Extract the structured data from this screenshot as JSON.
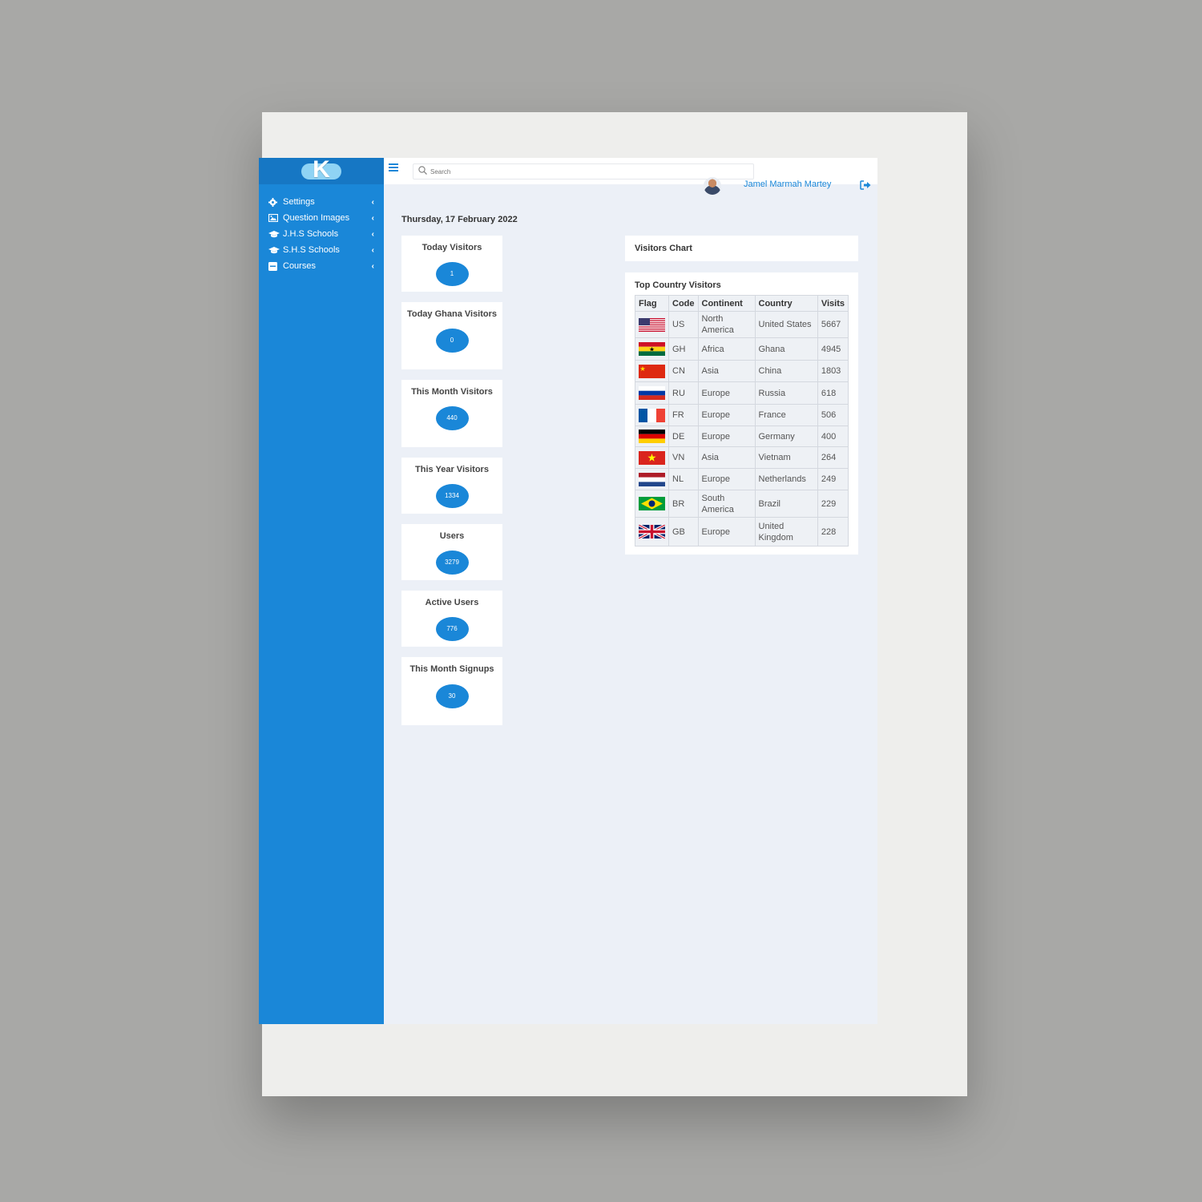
{
  "app": {
    "logo_letter": "K",
    "logo_colors": {
      "letter": "#ffffff",
      "cloud": "#8fd3f4"
    }
  },
  "sidebar": {
    "items": [
      {
        "label": "Settings",
        "icon": "gear-icon"
      },
      {
        "label": "Question Images",
        "icon": "image-icon"
      },
      {
        "label": "J.H.S Schools",
        "icon": "graduation-cap-icon"
      },
      {
        "label": "S.H.S Schools",
        "icon": "graduation-cap-icon"
      },
      {
        "label": "Courses",
        "icon": "book-icon"
      }
    ]
  },
  "header": {
    "search_placeholder": "Search",
    "user_name": "Jamel Marmah Martey"
  },
  "main": {
    "date": "Thursday, 17 February 2022",
    "stats": [
      {
        "title": "Today Visitors",
        "value": "1"
      },
      {
        "title": "Today Ghana Visitors",
        "value": "0"
      },
      {
        "title": "This Month Visitors",
        "value": "440"
      },
      {
        "title": "This Year Visitors",
        "value": "1334"
      },
      {
        "title": "Users",
        "value": "3279"
      },
      {
        "title": "Active Users",
        "value": "776"
      },
      {
        "title": "This Month Signups",
        "value": "30"
      }
    ],
    "chart_panel_title": "Visitors Chart",
    "top_country": {
      "title": "Top Country Visitors",
      "columns": [
        "Flag",
        "Code",
        "Continent",
        "Country",
        "Visits"
      ],
      "rows": [
        {
          "code": "US",
          "continent": "North America",
          "country": "United States",
          "visits": "5667"
        },
        {
          "code": "GH",
          "continent": "Africa",
          "country": "Ghana",
          "visits": "4945"
        },
        {
          "code": "CN",
          "continent": "Asia",
          "country": "China",
          "visits": "1803"
        },
        {
          "code": "RU",
          "continent": "Europe",
          "country": "Russia",
          "visits": "618"
        },
        {
          "code": "FR",
          "continent": "Europe",
          "country": "France",
          "visits": "506"
        },
        {
          "code": "DE",
          "continent": "Europe",
          "country": "Germany",
          "visits": "400"
        },
        {
          "code": "VN",
          "continent": "Asia",
          "country": "Vietnam",
          "visits": "264"
        },
        {
          "code": "NL",
          "continent": "Europe",
          "country": "Netherlands",
          "visits": "249"
        },
        {
          "code": "BR",
          "continent": "South America",
          "country": "Brazil",
          "visits": "229"
        },
        {
          "code": "GB",
          "continent": "Europe",
          "country": "United Kingdom",
          "visits": "228"
        }
      ]
    }
  },
  "colors": {
    "sidebar": "#1a87d8",
    "accent": "#1a87d8",
    "page_bg": "#ecf0f7"
  }
}
